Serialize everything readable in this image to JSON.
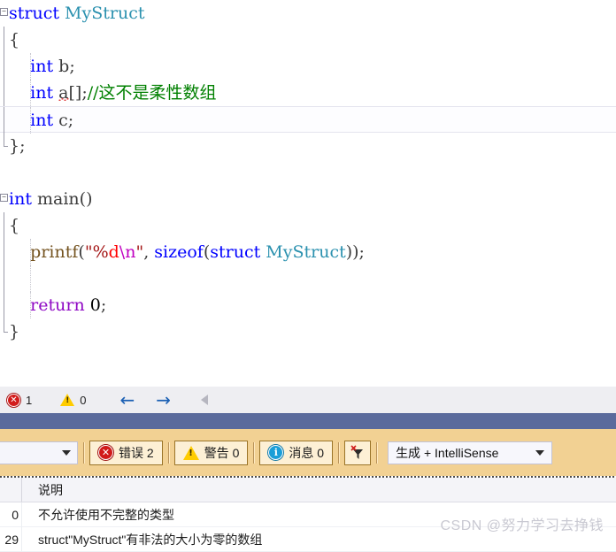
{
  "editor": {
    "lines": [
      {
        "n": 1,
        "marker": "collapse",
        "indent": false,
        "tokens": [
          {
            "t": "struct ",
            "c": "kw"
          },
          {
            "t": "MyStruct",
            "c": "type"
          }
        ]
      },
      {
        "n": 2,
        "marker": "vline",
        "indent": false,
        "tokens": [
          {
            "t": "{",
            "c": "plain"
          }
        ]
      },
      {
        "n": 3,
        "marker": "vline",
        "indent": true,
        "tokens": [
          {
            "t": "    ",
            "c": "plain"
          },
          {
            "t": "int",
            "c": "kw"
          },
          {
            "t": " b;",
            "c": "plain"
          }
        ]
      },
      {
        "n": 4,
        "marker": "vline",
        "indent": true,
        "tokens": [
          {
            "t": "    ",
            "c": "plain"
          },
          {
            "t": "int",
            "c": "kw"
          },
          {
            "t": " ",
            "c": "plain"
          },
          {
            "t": "a",
            "c": "plain",
            "squiggle": true
          },
          {
            "t": "[];",
            "c": "plain"
          },
          {
            "t": "//这不是柔性数组",
            "c": "cmt"
          }
        ]
      },
      {
        "n": 5,
        "marker": "vline",
        "indent": true,
        "highlight": true,
        "tokens": [
          {
            "t": "    ",
            "c": "plain"
          },
          {
            "t": "int",
            "c": "kw"
          },
          {
            "t": " c;",
            "c": "plain"
          }
        ]
      },
      {
        "n": 6,
        "marker": "vline-end",
        "indent": false,
        "tokens": [
          {
            "t": "};",
            "c": "plain"
          }
        ]
      },
      {
        "n": 7,
        "marker": "none",
        "indent": false,
        "tokens": []
      },
      {
        "n": 8,
        "marker": "collapse",
        "indent": false,
        "tokens": [
          {
            "t": "int",
            "c": "kw"
          },
          {
            "t": " ",
            "c": "plain"
          },
          {
            "t": "main",
            "c": "plain"
          },
          {
            "t": "()",
            "c": "plain"
          }
        ]
      },
      {
        "n": 9,
        "marker": "vline",
        "indent": false,
        "tokens": [
          {
            "t": "{",
            "c": "plain"
          }
        ]
      },
      {
        "n": 10,
        "marker": "vline",
        "indent": true,
        "tokens": [
          {
            "t": "    ",
            "c": "plain"
          },
          {
            "t": "printf",
            "c": "fn"
          },
          {
            "t": "(",
            "c": "plain"
          },
          {
            "t": "\"%",
            "c": "str"
          },
          {
            "t": "d",
            "c": "fmt"
          },
          {
            "t": "\\n",
            "c": "esc"
          },
          {
            "t": "\"",
            "c": "str"
          },
          {
            "t": ", ",
            "c": "plain"
          },
          {
            "t": "sizeof",
            "c": "kw"
          },
          {
            "t": "(",
            "c": "plain"
          },
          {
            "t": "struct ",
            "c": "kw"
          },
          {
            "t": "MyStruct",
            "c": "type"
          },
          {
            "t": "));",
            "c": "plain"
          }
        ]
      },
      {
        "n": 11,
        "marker": "vline",
        "indent": true,
        "tokens": []
      },
      {
        "n": 12,
        "marker": "vline",
        "indent": true,
        "tokens": [
          {
            "t": "    ",
            "c": "plain"
          },
          {
            "t": "return",
            "c": "ctrl"
          },
          {
            "t": " ",
            "c": "plain"
          },
          {
            "t": "0",
            "c": "num"
          },
          {
            "t": ";",
            "c": "plain"
          }
        ]
      },
      {
        "n": 13,
        "marker": "vline-end",
        "indent": false,
        "tokens": [
          {
            "t": "}",
            "c": "plain"
          }
        ]
      }
    ]
  },
  "navbar": {
    "error_icon": "error-circle-icon",
    "error_count": "1",
    "warning_icon": "warning-triangle-icon",
    "warning_count": "0",
    "back_arrow": "←",
    "forward_arrow": "→",
    "collapse_triangle": "collapse-left-icon"
  },
  "toolbar": {
    "scope_combo_value": "",
    "errors_label": "错误 2",
    "warnings_label": "警告 0",
    "messages_label": "消息 0",
    "errors_icon_glyph": "✕",
    "warnings_icon_glyph": "!",
    "messages_icon_glyph": "i",
    "filter_icon": "clear-filter-icon",
    "build_filter_value": "生成 + IntelliSense"
  },
  "error_list": {
    "columns": {
      "code": "",
      "description": "说明"
    },
    "rows": [
      {
        "code": "0",
        "description": "不允许使用不完整的类型"
      },
      {
        "code": "29",
        "description": "struct\"MyStruct\"有非法的大小为零的数组"
      }
    ]
  },
  "watermark": {
    "text": "CSDN @努力学习去挣钱"
  },
  "colors": {
    "keyword": "#0000ff",
    "user_type": "#2b91af",
    "comment": "#008000",
    "string": "#a31515",
    "control": "#8f08c4",
    "function": "#74531f",
    "error_red": "#d11a1a",
    "warning_yellow": "#ffcc00",
    "info_blue": "#1a9ed8",
    "toolbar_tan": "#f2d193",
    "separator_blue": "#5a6a9c"
  }
}
